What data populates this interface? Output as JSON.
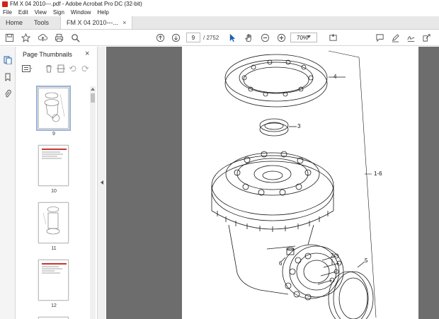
{
  "window": {
    "title": "FM X   04 2010---.pdf - Adobe Acrobat Pro DC (32-bit)"
  },
  "menu": [
    "File",
    "Edit",
    "View",
    "Sign",
    "Window",
    "Help"
  ],
  "tabs": {
    "home": "Home",
    "tools": "Tools",
    "document": "FM X   04 2010---...",
    "close": "×"
  },
  "toolbar": {
    "current_page": "9",
    "total_pages": "/ 2752",
    "zoom": "70%"
  },
  "thumbnails": {
    "title": "Page Thumbnails",
    "close": "×",
    "pages": [
      {
        "number": "9",
        "selected": true
      },
      {
        "number": "10",
        "selected": false
      },
      {
        "number": "11",
        "selected": false
      },
      {
        "number": "12",
        "selected": false
      }
    ]
  },
  "drawing": {
    "callouts": {
      "c4": "4",
      "c3": "3",
      "c16": "1-6",
      "c2": "2",
      "c6": "6",
      "c5": "5"
    }
  },
  "colors": {
    "accent": "#d4211a",
    "viewer_bg": "#6d6d6d",
    "selection": "#9ab2d8"
  }
}
